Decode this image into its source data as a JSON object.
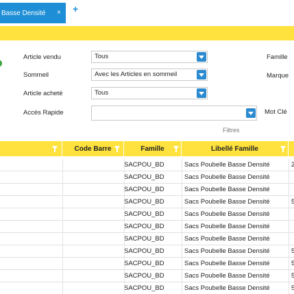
{
  "tab": {
    "label": "Basse Densité",
    "close_glyph": "×",
    "add_glyph": "+"
  },
  "filters": {
    "article_vendu": {
      "label": "Article vendu",
      "value": "Tous"
    },
    "sommeil": {
      "label": "Sommeil",
      "value": "Avec les Articles en sommeil"
    },
    "article_achete": {
      "label": "Article acheté",
      "value": "Tous"
    },
    "acces_rapide": {
      "label": "Accès Rapide",
      "value": ""
    },
    "famille_label": "Famille",
    "marque_label": "Marque",
    "mot_cle_label": "Mot Clé",
    "section_label": "Filtres"
  },
  "grid": {
    "columns": [
      "",
      "Code Barre",
      "Famille",
      "Libellé Famille"
    ],
    "rows": [
      {
        "code_barre": "",
        "famille": "SACPOU_BD",
        "libelle": "Sacs Poubelle Basse Densité",
        "next": "2"
      },
      {
        "code_barre": "",
        "famille": "SACPOU_BD",
        "libelle": "Sacs Poubelle Basse Densité",
        "next": ""
      },
      {
        "code_barre": "",
        "famille": "SACPOU_BD",
        "libelle": "Sacs Poubelle Basse Densité",
        "next": ""
      },
      {
        "code_barre": "",
        "famille": "SACPOU_BD",
        "libelle": "Sacs Poubelle Basse Densité",
        "next": "5"
      },
      {
        "code_barre": "",
        "famille": "SACPOU_BD",
        "libelle": "Sacs Poubelle Basse Densité",
        "next": ""
      },
      {
        "code_barre": "",
        "famille": "SACPOU_BD",
        "libelle": "Sacs Poubelle Basse Densité",
        "next": ""
      },
      {
        "code_barre": "",
        "famille": "SACPOU_BD",
        "libelle": "Sacs Poubelle Basse Densité",
        "next": ""
      },
      {
        "code_barre": "",
        "famille": "SACPOU_BD",
        "libelle": "Sacs Poubelle Basse Densité",
        "next": "5"
      },
      {
        "code_barre": "",
        "famille": "SACPOU_BD",
        "libelle": "Sacs Poubelle Basse Densité",
        "next": "5"
      },
      {
        "code_barre": "",
        "famille": "SACPOU_BD",
        "libelle": "Sacs Poubelle Basse Densité",
        "next": "5"
      },
      {
        "code_barre": "",
        "famille": "SACPOU_BD",
        "libelle": "Sacs Poubelle Basse Densité",
        "next": "5"
      }
    ]
  },
  "colors": {
    "accent_blue": "#1e8fd6",
    "yellow": "#ffe23d"
  },
  "icons": {
    "dropdown": "chevron-down-icon",
    "filter": "funnel-icon"
  }
}
